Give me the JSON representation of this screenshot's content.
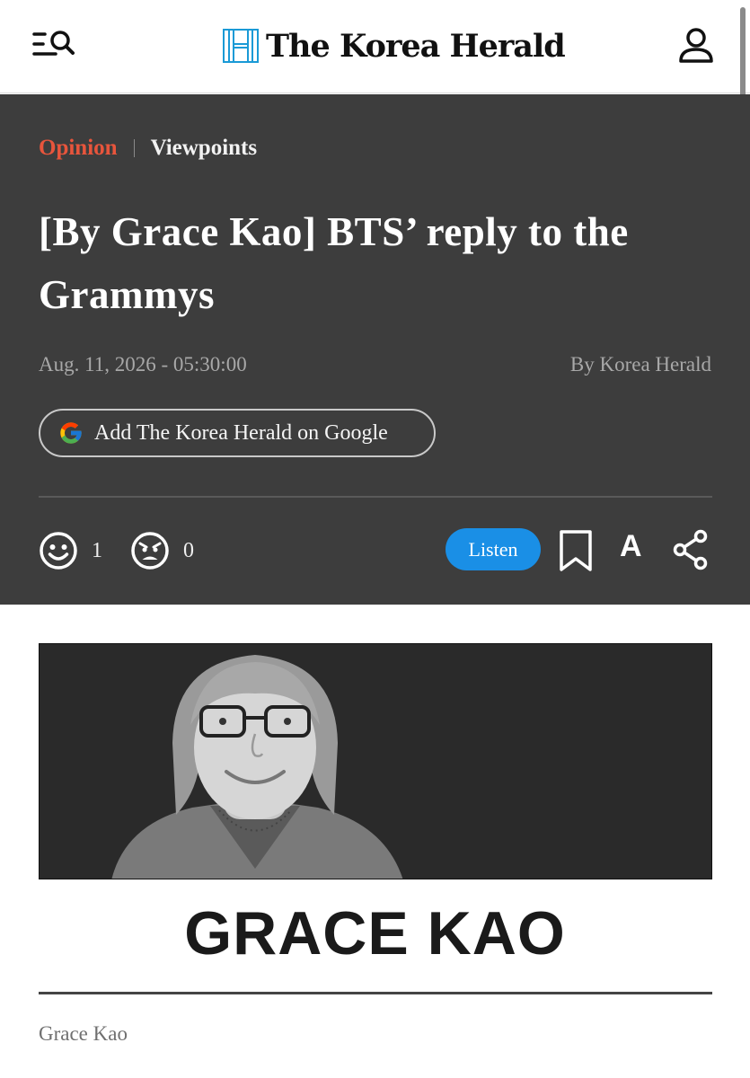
{
  "header": {
    "logo_text": "The Korea Herald",
    "menu_icon": "menu-search-icon",
    "user_icon": "user-icon"
  },
  "article": {
    "section": "Opinion",
    "subsection": "Viewpoints",
    "title": "[By Grace Kao] BTS’ reply to the Grammys",
    "date": "Aug. 11, 2026 - 05:30:00",
    "byline": "By Korea Herald",
    "google_button": "Add The Korea Herald on Google"
  },
  "actions": {
    "like_count": "1",
    "angry_count": "0",
    "listen_label": "Listen",
    "font_label": "A"
  },
  "image": {
    "name_banner": "GRACE KAO",
    "caption": "Grace Kao"
  },
  "colors": {
    "accent_red": "#e8553c",
    "listen_blue": "#1a8fe6",
    "header_bg": "#3d3d3d",
    "logo_blue": "#1a9ad6"
  }
}
